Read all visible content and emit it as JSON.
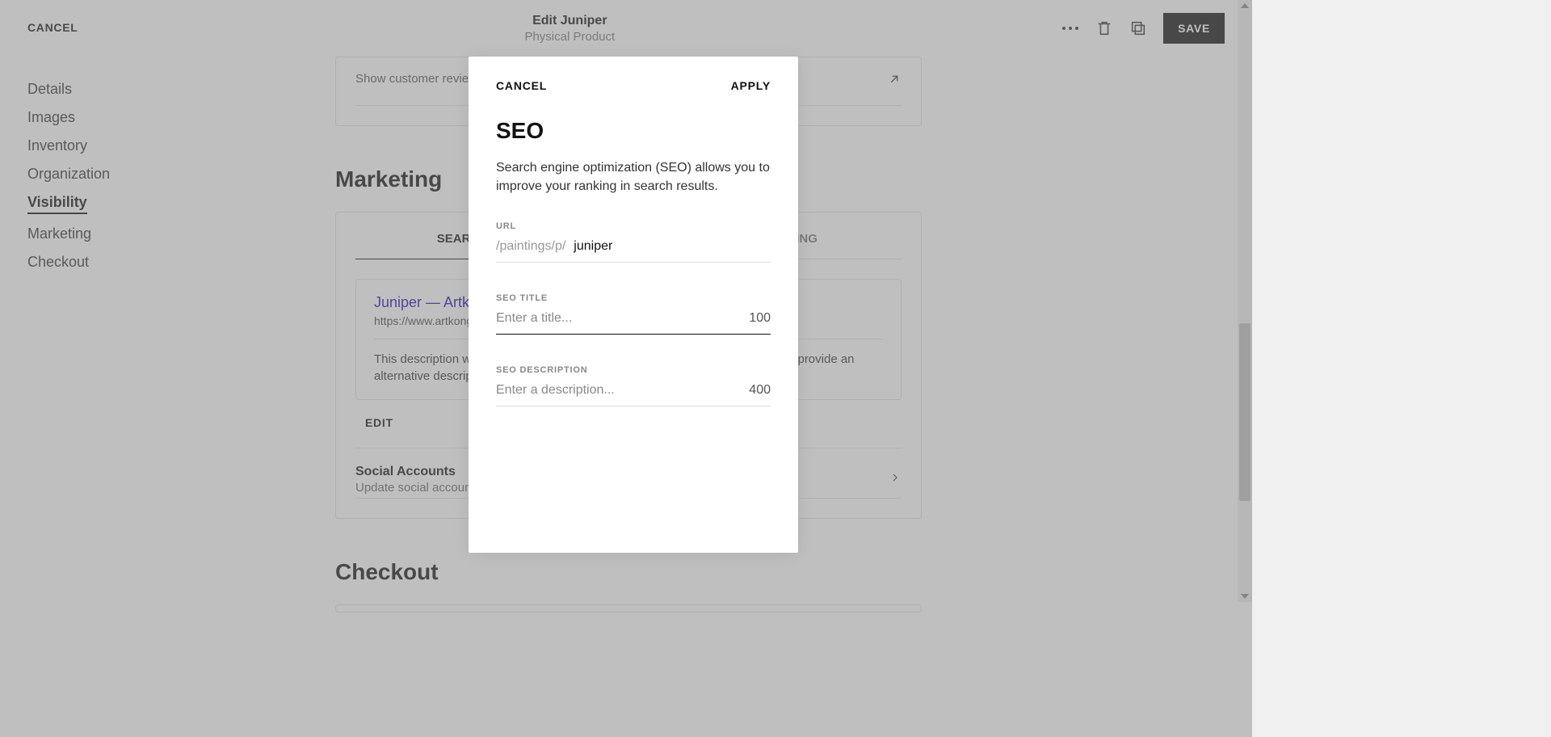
{
  "header": {
    "cancel": "CANCEL",
    "title": "Edit Juniper",
    "subtitle": "Physical Product",
    "save": "SAVE"
  },
  "sidebar": {
    "items": [
      {
        "label": "Details"
      },
      {
        "label": "Images"
      },
      {
        "label": "Inventory"
      },
      {
        "label": "Organization"
      },
      {
        "label": "Visibility"
      },
      {
        "label": "Marketing"
      },
      {
        "label": "Checkout"
      }
    ]
  },
  "reviews": {
    "text": "Show customer reviews on product page"
  },
  "marketing": {
    "heading": "Marketing",
    "tabs": {
      "search": "SEARCH RESULTS",
      "social": "SOCIAL SHARING"
    },
    "preview": {
      "title": "Juniper — Artkong.art",
      "url": "https://www.artkong.art/...",
      "desc": "This description will appear under the page title in search results. You can also provide an alternative description."
    },
    "edit": "EDIT",
    "social_row": {
      "title": "Social Accounts",
      "sub": "Update social accounts when publishing"
    }
  },
  "checkout": {
    "heading": "Checkout"
  },
  "modal": {
    "cancel": "CANCEL",
    "apply": "APPLY",
    "title": "SEO",
    "desc": "Search engine optimization (SEO) allows you to improve your ranking in search results.",
    "fields": {
      "url_label": "URL",
      "url_prefix": "/paintings/p/",
      "url_value": "juniper",
      "title_label": "SEO TITLE",
      "title_placeholder": "Enter a title...",
      "title_count": "100",
      "desc_label": "SEO DESCRIPTION",
      "desc_placeholder": "Enter a description...",
      "desc_count": "400"
    }
  }
}
